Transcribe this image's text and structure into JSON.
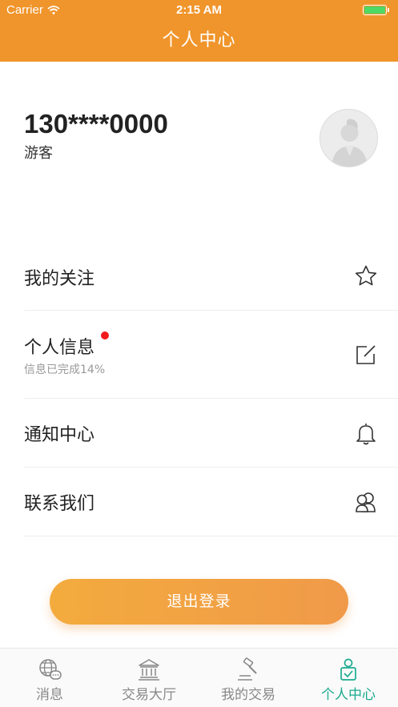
{
  "status_bar": {
    "carrier": "Carrier",
    "time": "2:15 AM"
  },
  "header": {
    "title": "个人中心"
  },
  "profile": {
    "phone": "130****0000",
    "role": "游客"
  },
  "menu": {
    "follow": {
      "label": "我的关注",
      "icon": "star-icon"
    },
    "info": {
      "label": "个人信息",
      "sub": "信息已完成14%",
      "icon": "edit-icon",
      "has_badge": true
    },
    "notify": {
      "label": "通知中心",
      "icon": "bell-icon"
    },
    "contact": {
      "label": "联系我们",
      "icon": "contacts-icon"
    }
  },
  "logout": {
    "label": "退出登录"
  },
  "tabs": [
    {
      "label": "消息",
      "icon": "globe-chat-icon",
      "active": false
    },
    {
      "label": "交易大厅",
      "icon": "bank-icon",
      "active": false
    },
    {
      "label": "我的交易",
      "icon": "gavel-icon",
      "active": false
    },
    {
      "label": "个人中心",
      "icon": "person-badge-icon",
      "active": true
    }
  ],
  "colors": {
    "header": "#f0952b",
    "accent": "#1aab8f",
    "badge": "#f21b1b",
    "battery": "#4cd964"
  }
}
